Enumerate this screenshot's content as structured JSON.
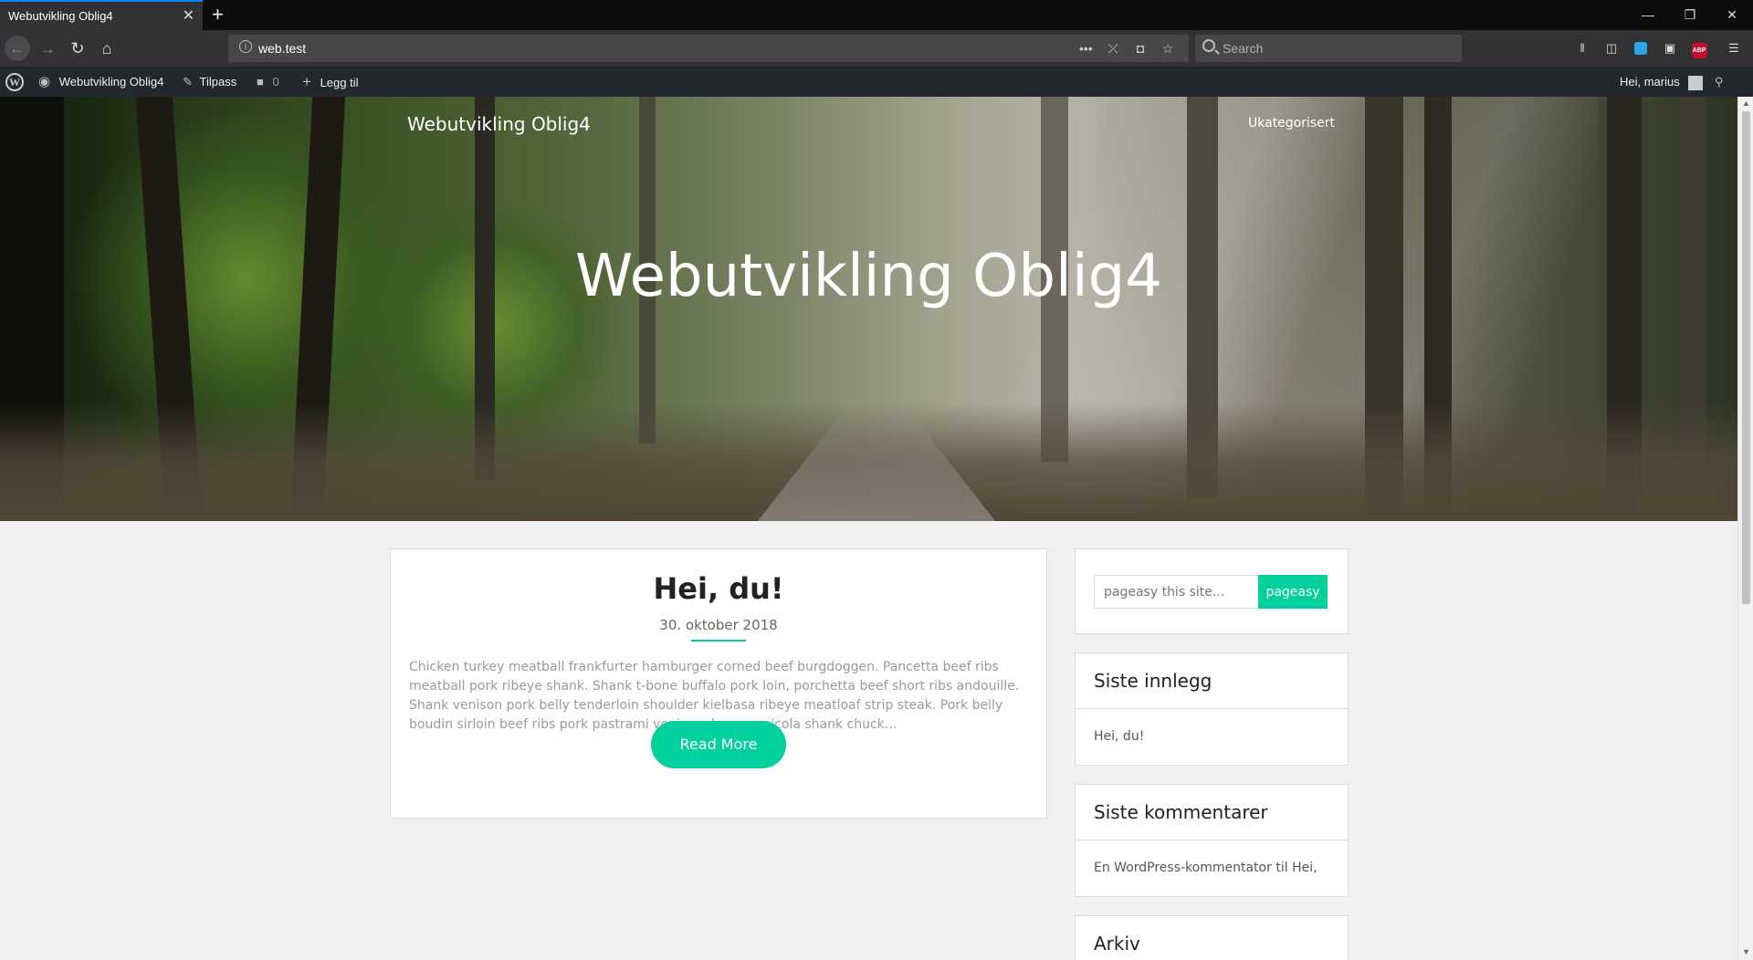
{
  "browser": {
    "tab_title": "Webutvikling Oblig4",
    "tab_close": "✕",
    "new_tab": "+",
    "url": "web.test",
    "search_placeholder": "Search",
    "url_info": "i",
    "url_actions": [
      "•••",
      "⤫",
      "◘",
      "☆"
    ],
    "toolbar_icons": [
      "library-icon",
      "sidebar-icon",
      "extension-icon",
      "reader-icon",
      "abp-icon",
      "menu-icon"
    ],
    "abp_label": "ABP"
  },
  "adminbar": {
    "site_name": "Webutvikling Oblig4",
    "customize": "Tilpass",
    "comments_count": "0",
    "add_new": "Legg til",
    "greeting": "Hei, marius"
  },
  "hero": {
    "site_title": "Webutvikling Oblig4",
    "menu_item": "Ukategorisert",
    "title": "Webutvikling Oblig4"
  },
  "post": {
    "title": "Hei, du!",
    "date": "30. oktober 2018",
    "excerpt": "Chicken turkey meatball frankfurter hamburger corned beef burgdoggen. Pancetta beef ribs meatball pork ribeye shank. Shank t-bone buffalo pork loin, porchetta beef short ribs andouille. Shank venison pork belly tenderloin shoulder kielbasa ribeye meatloaf strip steak. Pork belly boudin sirloin beef ribs pork pastrami venison doner capicola shank chuck…",
    "read_more": "Read More"
  },
  "sidebar": {
    "search_placeholder": "pageasy this site...",
    "search_button": "pageasy",
    "recent_title": "Siste innlegg",
    "recent_item": "Hei, du!",
    "comments_title": "Siste kommentarer",
    "comment_author": "En WordPress-kommentator",
    "comment_on": "til",
    "comment_post": "Hei, du!",
    "archive_title": "Arkiv"
  },
  "colors": {
    "accent": "#02d19e",
    "adminbar": "#23282d",
    "browser_dark": "#0c0c0d"
  }
}
